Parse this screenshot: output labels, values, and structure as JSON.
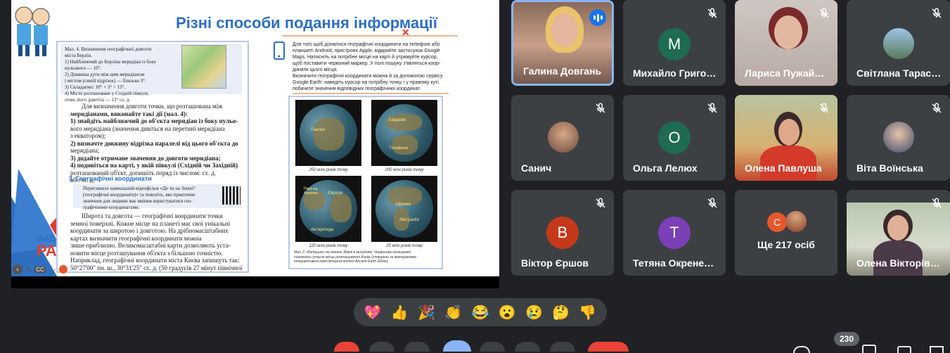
{
  "slide": {
    "title": "Різні способи подання інформації",
    "box1": {
      "lines": [
        "Мал. 4. Визначення географічної довготи",
        "міста Берлін.",
        "1) Найближчий до Берліна меридіан із боку",
        "    нульового — 10°.",
        "2) Довжина дуги між цим меридіаном",
        "    і містом (синій відрізок) — близько 3°.",
        "3) Складаємо: 10° + 3° = 13°.",
        "4) Місто розташоване у Східній півкулі,",
        "    отже, його довгота — 13° сх. д."
      ]
    },
    "main_text": [
      "Для визначення довготи точки, що розташована між",
      "меридіанами, виконайте такі дії (мал. 4):",
      "1) знайдіть найближчий до об'єкта меридіан із боку нульо-",
      "    вого меридіана (значення дивіться на перетині меридіана",
      "    з екватором);",
      "2) визначте довжину відрізка паралелі від цього об'єкта до",
      "    меридіана;",
      "3) додайте отримане значення до довготи меридіана;",
      "4) подивіться на карті, у якій півкулі (Східній чи Західній)",
      "    розташований об'єкт, допишіть поряд із числом: сх. д.",
      "    або зх. д."
    ],
    "section_heading": "3.  Географічні координати",
    "video_note": [
      "Перегляньте навчальний відеофільм «Де ти на Землі?",
      "(географічні координати)» та поясніть, яке практичне",
      "значення для людини має вміння користуватися гео-",
      "графічними координатами."
    ],
    "para2": [
      "Широта та довгота — географічні координати точки",
      "земної поверхні. Кожне місце на планеті має свої унікальні",
      "координати за широтою і довготою. На дрібномасштабних",
      "картах визначити географічні координати можна",
      "лише приблизно. Великомасштабні карти дозволяють уста-",
      "новити місце розташування об'єкта з більшою точністю.",
      "Наприклад, географічні координати міста Києва запишуть так:",
      "50°27'00\" пн. ш., 30°31'25\" сх. д. (50 градусів 27 мінут північної"
    ],
    "right_text": [
      "Для того щоб дізнатися географічні координати на телефоні або",
      "планшеті Android, пристроях Apple, відкрийте застосунок Google",
      "Maps. Натисніть на потрібне місце на карті й утримуйте курсор,",
      "щоб поставити червоний маркер. У полі пошуку з'являться коор-",
      "динати цього місця.",
      "Визначити географічні координати можна й за допомогою сервісу",
      "Google Earth: наведіть курсор на потрібну точку, і у правому куті",
      "побачите значення відповідних географічних координат."
    ],
    "globe_captions": [
      "250 млн років тому",
      "200 млн років тому",
      "120 млн років тому",
      "20 млн років тому"
    ],
    "globe_labels": [
      "Пангея",
      "Лавразія",
      "Гондвана",
      "Північна Америка",
      "Євразія",
      "Африка",
      "Антарктида",
      "Австралія"
    ],
    "figure_caption": [
      "Мал. 2. Материки та океани Землі в минулому. Червоними кольорами",
      "позначено сучасне місце розташування Києва (створено за матеріалами",
      "інтерактивної комп'ютерної моделі Ancient Earth Globe)."
    ],
    "side_logo": [
      "ВИД",
      "РА"
    ]
  },
  "participants": [
    {
      "name": "Галина Довгань",
      "type": "video",
      "speaking": true
    },
    {
      "name": "Михайло Григо…",
      "type": "letter",
      "letter": "M",
      "color": "#1e6b52"
    },
    {
      "name": "Лариса Пужай…",
      "type": "video"
    },
    {
      "name": "Світлана Тарас…",
      "type": "photo"
    },
    {
      "name": "Санич",
      "type": "photo"
    },
    {
      "name": "Ольга Лелюх",
      "type": "letter",
      "letter": "O",
      "color": "#1e6b52"
    },
    {
      "name": "Олена Павлуша",
      "type": "video"
    },
    {
      "name": "Віта Воїнська",
      "type": "photo"
    },
    {
      "name": "Віктор Єршов",
      "type": "letter",
      "letter": "B",
      "color": "#c5391a"
    },
    {
      "name": "Тетяна Окрене…",
      "type": "letter",
      "letter": "T",
      "color": "#7b3fb8"
    },
    {
      "name": "Ще 217 осіб",
      "type": "more",
      "letter": "C",
      "color": "#e8572c"
    },
    {
      "name": "Олена Вікторів…",
      "type": "video"
    }
  ],
  "reactions": [
    "💖",
    "👍",
    "🎉",
    "👏",
    "😂",
    "😮",
    "😢",
    "🤔",
    "👎"
  ],
  "participant_count": "230",
  "colors": {
    "background": "#202124",
    "tile": "#3c4043",
    "speaking_border": "#8ab4f8",
    "accent_blue": "#2e6fc0"
  }
}
